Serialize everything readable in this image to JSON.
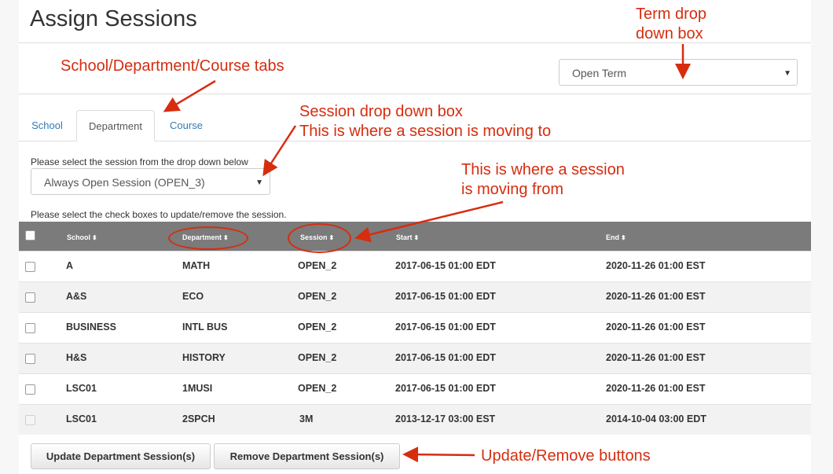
{
  "page": {
    "title": "Assign Sessions"
  },
  "term_select": {
    "value": "Open Term"
  },
  "tabs": [
    {
      "label": "School",
      "active": false
    },
    {
      "label": "Department",
      "active": true
    },
    {
      "label": "Course",
      "active": false
    }
  ],
  "session_prompt": "Please select the session from the drop down below",
  "session_select": {
    "value": "Always Open Session (OPEN_3)"
  },
  "checkbox_prompt": "Please select the check boxes to update/remove the session.",
  "table": {
    "columns": [
      "School",
      "Department",
      "Session",
      "Start",
      "End"
    ],
    "rows": [
      {
        "school": "A",
        "department": "MATH",
        "session": "OPEN_2",
        "start": "2017-06-15 01:00 EDT",
        "end": "2020-11-26 01:00 EST",
        "enabled": true
      },
      {
        "school": "A&S",
        "department": "ECO",
        "session": "OPEN_2",
        "start": "2017-06-15 01:00 EDT",
        "end": "2020-11-26 01:00 EST",
        "enabled": true
      },
      {
        "school": "BUSINESS",
        "department": "INTL BUS",
        "session": "OPEN_2",
        "start": "2017-06-15 01:00 EDT",
        "end": "2020-11-26 01:00 EST",
        "enabled": true
      },
      {
        "school": "H&S",
        "department": "HISTORY",
        "session": "OPEN_2",
        "start": "2017-06-15 01:00 EDT",
        "end": "2020-11-26 01:00 EST",
        "enabled": true
      },
      {
        "school": "LSC01",
        "department": "1MUSI",
        "session": "OPEN_2",
        "start": "2017-06-15 01:00 EDT",
        "end": "2020-11-26 01:00 EST",
        "enabled": true
      },
      {
        "school": "LSC01",
        "department": "2SPCH",
        "session": "3M",
        "start": "2013-12-17 03:00 EST",
        "end": "2014-10-04 03:00 EDT",
        "enabled": false
      }
    ]
  },
  "buttons": {
    "update": "Update Department Session(s)",
    "remove": "Remove Department Session(s)"
  },
  "annotations": {
    "term": [
      "Term drop",
      "down box"
    ],
    "tabs": "School/Department/Course tabs",
    "session_dropdown": [
      "Session drop down box",
      "This is where a session is moving to"
    ],
    "moving_from": [
      "This is where a session",
      "is moving from"
    ],
    "buttons": "Update/Remove buttons",
    "color": "#d62d0f"
  },
  "icons": {
    "caret": "caret-down-icon",
    "sort": "sort-icon",
    "arrow": "arrow-icon",
    "checkbox": "checkbox-icon"
  }
}
